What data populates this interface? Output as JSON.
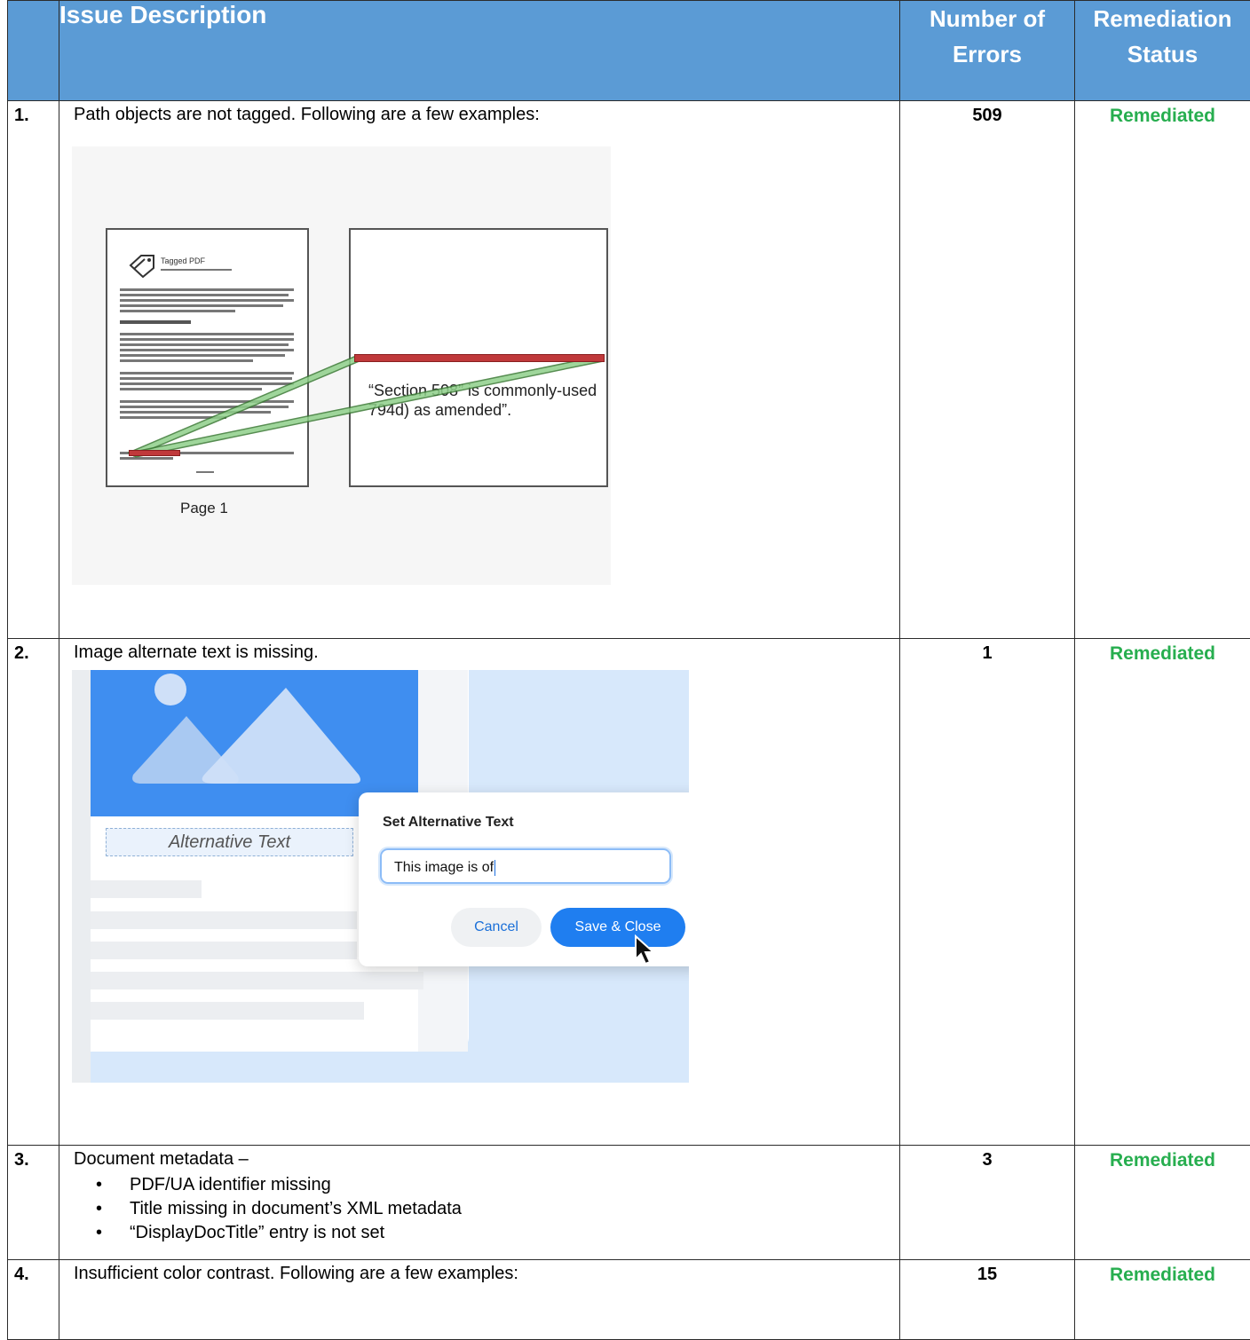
{
  "table": {
    "headers": {
      "number": "",
      "description": "Issue Description",
      "count_line1": "Number of",
      "count_line2": "Errors",
      "status_line1": "Remediation",
      "status_line2": "Status"
    },
    "rows": [
      {
        "number": "1.",
        "description": "Path objects are not tagged. Following are a few examples:",
        "count": "509",
        "status": "Remediated",
        "example": {
          "doc_title": "Tagged PDF",
          "zoom_line1": "“Section 508” is commonly-used",
          "zoom_line2": "794d) as amended”.",
          "page_label": "Page 1"
        }
      },
      {
        "number": "2.",
        "description": "Image alternate text is missing.",
        "count": "1",
        "status": "Remediated",
        "example": {
          "alt_label": "Alternative Text",
          "dialog_title": "Set Alternative Text",
          "input_value": "This image is of",
          "cancel_label": "Cancel",
          "save_label": "Save & Close"
        }
      },
      {
        "number": "3.",
        "description": "Document metadata –",
        "bullets": [
          "PDF/UA identifier missing",
          "Title missing in document’s XML metadata",
          "“DisplayDocTitle” entry is not set"
        ],
        "count": "3",
        "status": "Remediated"
      },
      {
        "number": "4.",
        "description": "Insufficient color contrast. Following are a few examples:",
        "count": "15",
        "status": "Remediated"
      }
    ]
  },
  "colors": {
    "header_bg": "#5b9bd5",
    "status_green": "#27ae4f",
    "highlight_red": "#c0393b",
    "highlight_green": "#8fd08a",
    "accent_blue": "#1f7ef0"
  }
}
